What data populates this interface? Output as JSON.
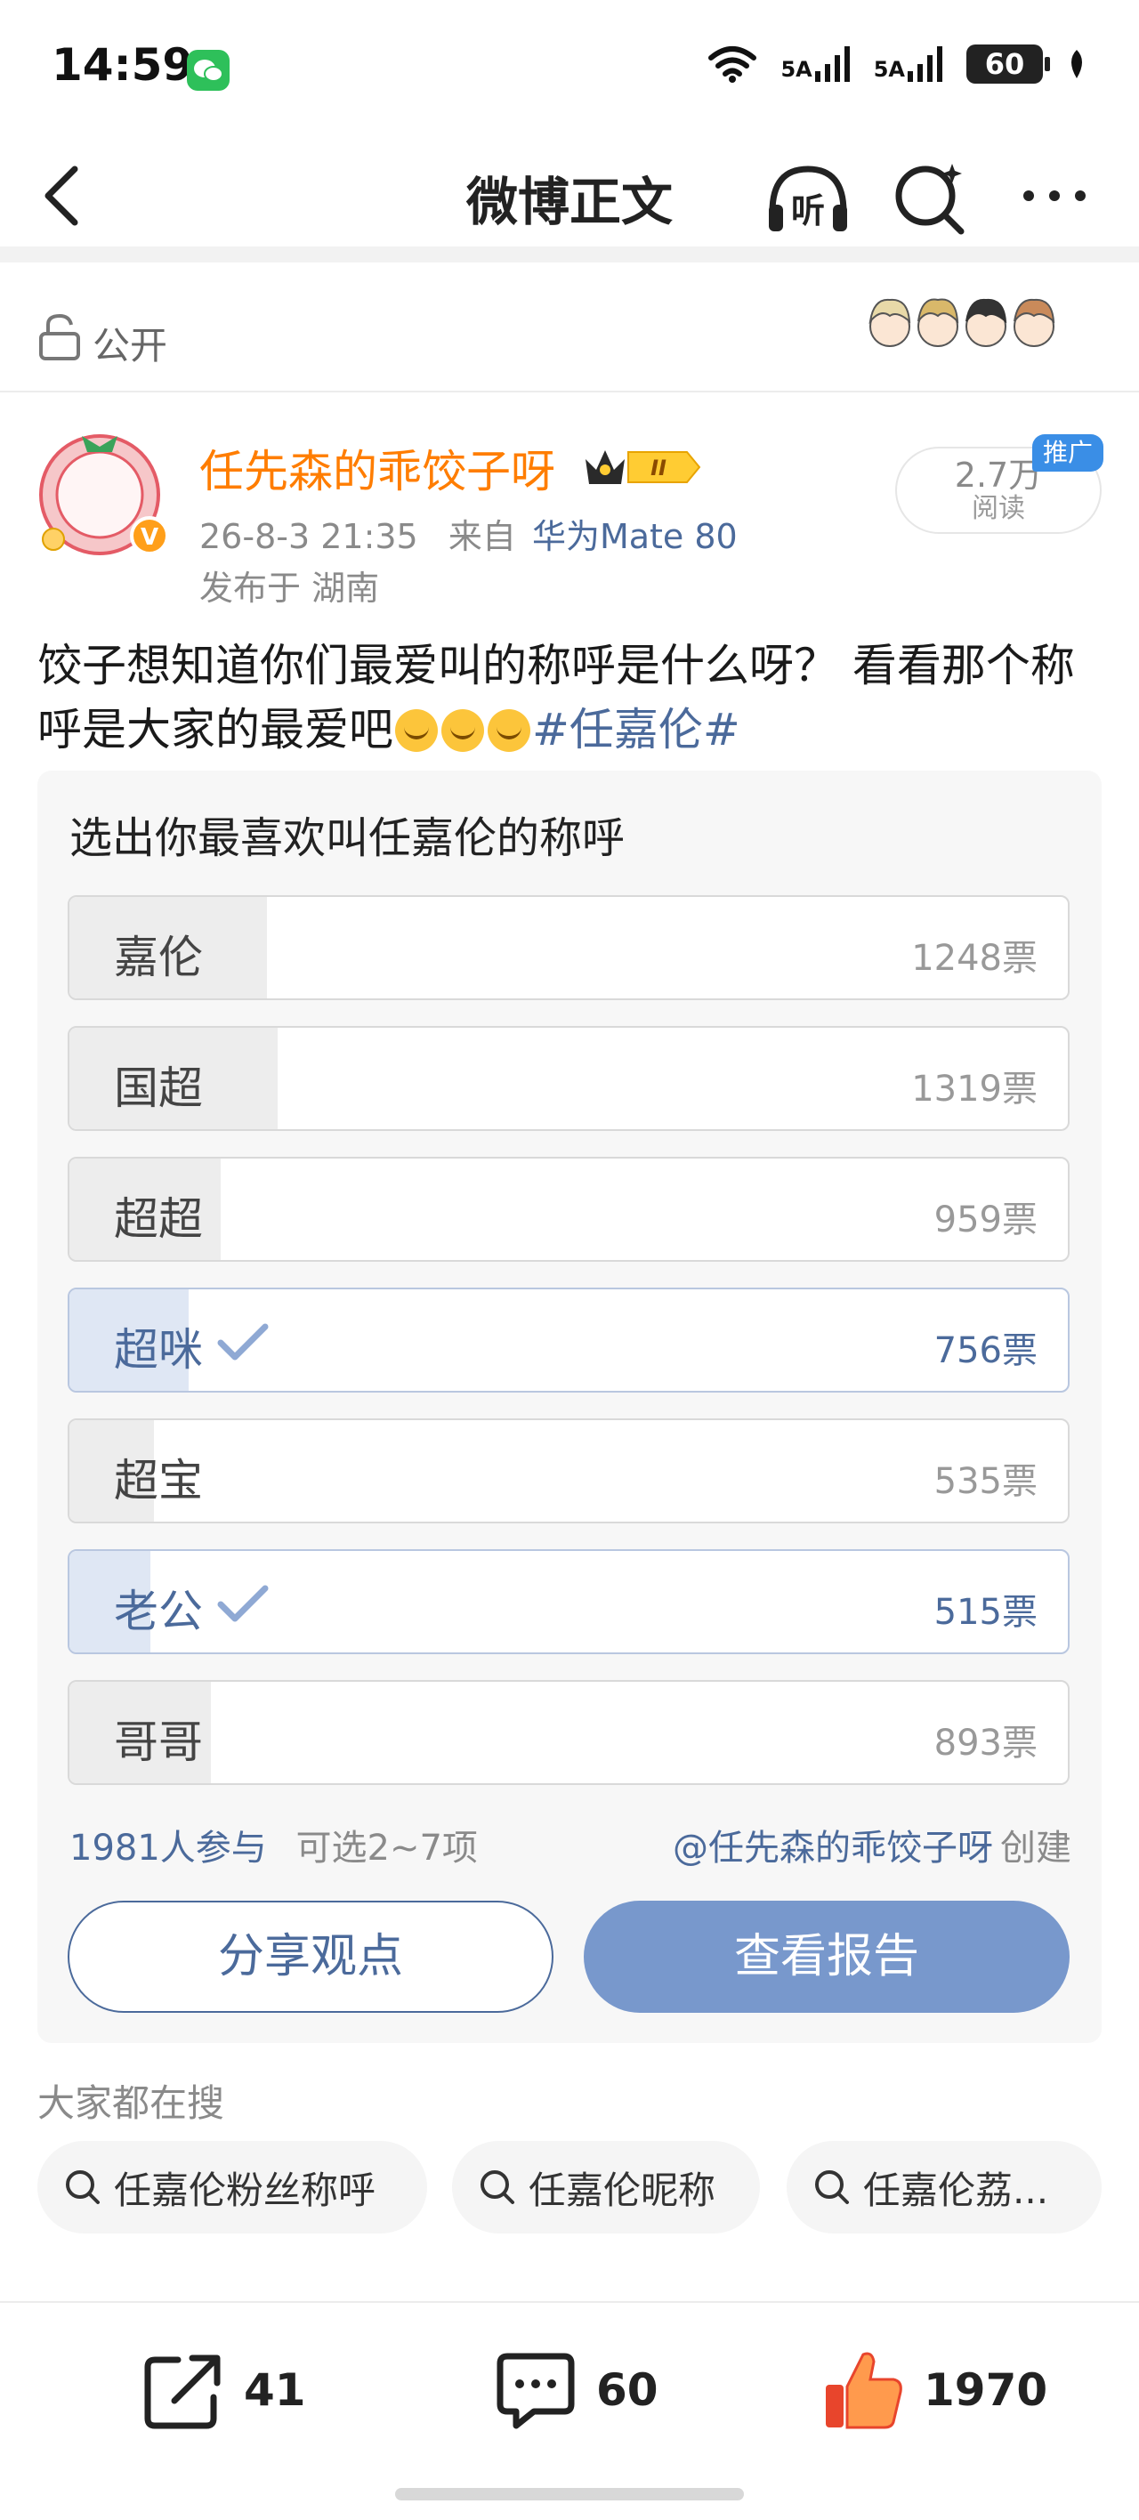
{
  "status_bar": {
    "time": "14:59",
    "network_labels": [
      "5A",
      "5A"
    ],
    "battery": "60"
  },
  "header": {
    "title": "微博正文",
    "listen_label": "听"
  },
  "visibility": {
    "label": "公开"
  },
  "post": {
    "author_name": "任先森的乖饺子呀",
    "vip_level": "II",
    "datetime": "26-8-3 21:35",
    "source_prefix": "来自",
    "device": "华为Mate 80",
    "location": "发布于 湖南",
    "reads_count": "2.7万",
    "reads_label": "阅读",
    "promo_tag": "推广",
    "text_before_emoji": "饺子想知道你们最爱叫的称呼是什么呀？  看看那个称呼是大家的最爱吧",
    "hashtag": "#任嘉伦#"
  },
  "poll": {
    "title": "选出你最喜欢叫任嘉伦的称呼",
    "options": [
      {
        "label": "嘉伦",
        "votes": "1248票",
        "share": 0.197,
        "voted": false
      },
      {
        "label": "国超",
        "votes": "1319票",
        "share": 0.208,
        "voted": false
      },
      {
        "label": "超超",
        "votes": "959票",
        "share": 0.151,
        "voted": false
      },
      {
        "label": "超咪",
        "votes": "756票",
        "share": 0.119,
        "voted": true
      },
      {
        "label": "超宝",
        "votes": "535票",
        "share": 0.084,
        "voted": false
      },
      {
        "label": "老公",
        "votes": "515票",
        "share": 0.081,
        "voted": true
      },
      {
        "label": "哥哥",
        "votes": "893票",
        "share": 0.141,
        "voted": false
      }
    ],
    "participants": "1981人参与",
    "rule": "可选2~7项",
    "creator": "@任先森的乖饺子呀",
    "creator_suffix": "创建",
    "share_button": "分享观点",
    "report_button": "查看报告"
  },
  "trending": {
    "label": "大家都在搜",
    "chips": [
      "任嘉伦粉丝称呼",
      "任嘉伦昵称",
      "任嘉伦荔..."
    ]
  },
  "actions": {
    "share_count": "41",
    "comment_count": "60",
    "like_count": "1970"
  },
  "colors": {
    "author_name": "#ff7d00",
    "link_blue": "#4b6a9b",
    "report_button": "#7898cc",
    "like_icon": "#ff8a3d",
    "promo_tag": "#3a8ee6"
  },
  "icons": [
    "back-icon",
    "headphones-icon",
    "search-icon",
    "more-icon",
    "lock-icon",
    "check-icon",
    "repost-icon",
    "comment-icon",
    "like-icon"
  ]
}
